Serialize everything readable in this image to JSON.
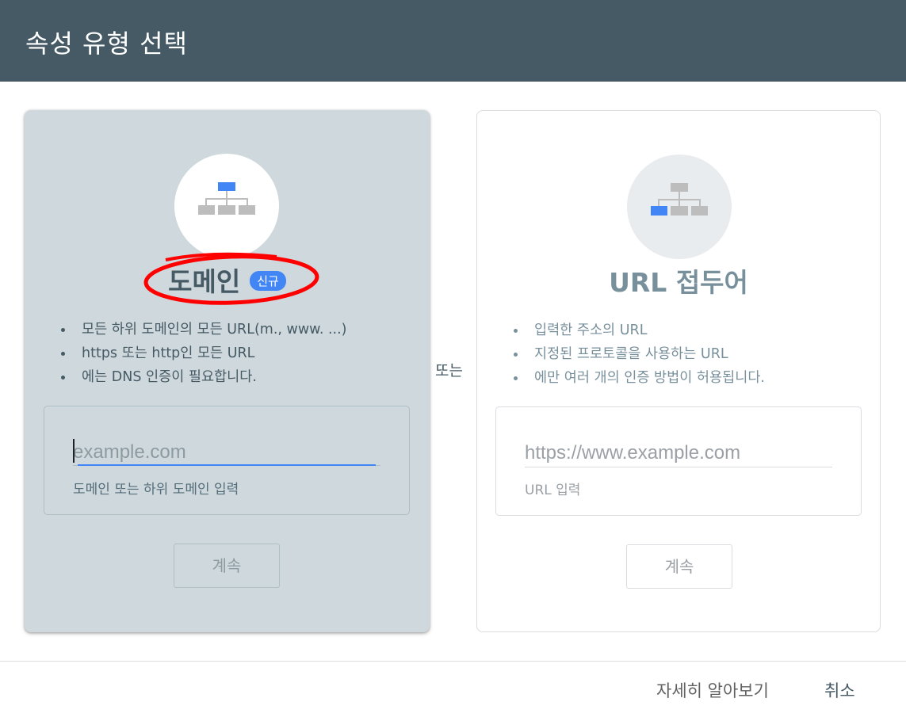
{
  "dialog": {
    "title": "속성 유형 선택"
  },
  "domain_card": {
    "title": "도메인",
    "badge": "신규",
    "bullets": [
      "모든 하위 도메인의 모든 URL(m., www. ...)",
      "https 또는 http인 모든 URL",
      "에는 DNS 인증이 필요합니다."
    ],
    "input_placeholder": "example.com",
    "input_value": "",
    "input_hint": "도메인 또는 하위 도메인 입력",
    "continue_label": "계속",
    "icon": "domain-sitemap-icon",
    "highlight_color": "#4285f4"
  },
  "separator": {
    "label": "또는"
  },
  "url_card": {
    "title": "URL 접두어",
    "bullets": [
      "입력한 주소의 URL",
      "지정된 프로토콜을 사용하는 URL",
      "에만 여러 개의 인증 방법이 허용됩니다."
    ],
    "input_placeholder": "https://www.example.com",
    "input_value": "",
    "input_hint": "URL 입력",
    "continue_label": "계속",
    "icon": "url-prefix-sitemap-icon"
  },
  "footer": {
    "learn_more": "자세히 알아보기",
    "cancel": "취소"
  },
  "annotation": {
    "color": "#ff0000"
  },
  "colors": {
    "header": "#455a64",
    "selected_card": "#cfd8dc",
    "accent": "#4285f4"
  }
}
